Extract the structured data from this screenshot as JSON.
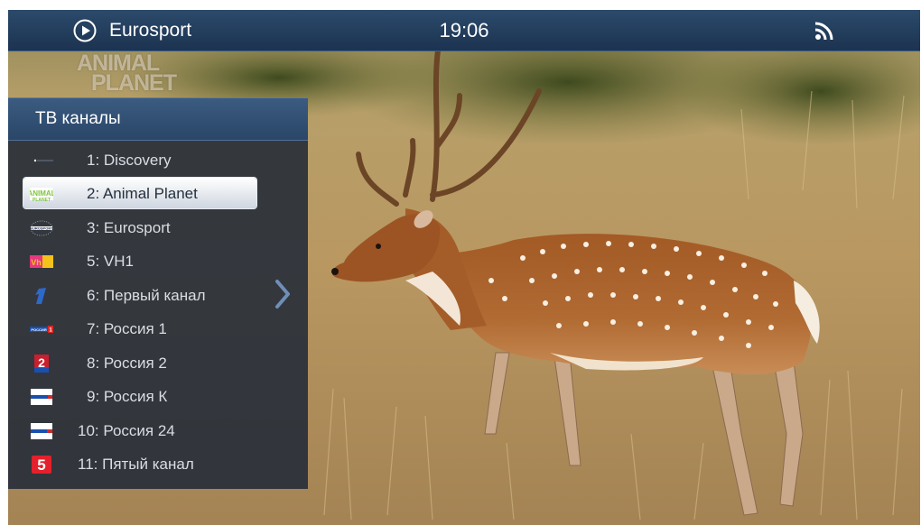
{
  "statusbar": {
    "channel_name": "Eurosport",
    "time": "19:06",
    "play_icon": "play-circle-icon",
    "signal_icon": "rss-icon"
  },
  "watermark": {
    "line1": "ANIMAL",
    "line2": "PLANET"
  },
  "panel": {
    "title": "ТВ каналы",
    "selected_index": 1,
    "channels": [
      {
        "label": "1: Discovery",
        "logo": "discovery-logo-icon"
      },
      {
        "label": "2: Animal Planet",
        "logo": "animal-planet-logo-icon"
      },
      {
        "label": "3: Eurosport",
        "logo": "eurosport-logo-icon"
      },
      {
        "label": "5: VH1",
        "logo": "vh1-logo-icon"
      },
      {
        "label": "6: Первый канал",
        "logo": "perviy-kanal-logo-icon"
      },
      {
        "label": "7: Россия 1",
        "logo": "rossiya-1-logo-icon"
      },
      {
        "label": "8: Россия 2",
        "logo": "rossiya-2-logo-icon"
      },
      {
        "label": "9: Россия К",
        "logo": "rossiya-k-logo-icon"
      },
      {
        "label": "10: Россия 24",
        "logo": "rossiya-24-logo-icon"
      },
      {
        "label": "11: Пятый канал",
        "logo": "pyatiy-kanal-logo-icon"
      }
    ],
    "next_icon": "chevron-right-icon"
  },
  "colors": {
    "statusbar": "#2c4a6c",
    "panel_header": "#3b5b80",
    "panel_body": "#1e2837",
    "selected_row": "#ffffff"
  }
}
